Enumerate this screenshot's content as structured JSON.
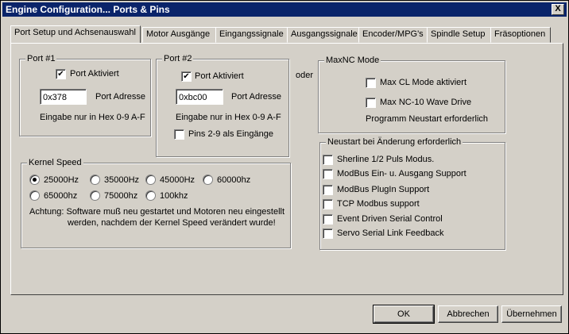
{
  "window": {
    "title": "Engine Configuration... Ports & Pins",
    "close_glyph": "X"
  },
  "tabs": [
    {
      "label": "Port Setup und Achsenauswahl",
      "active": true
    },
    {
      "label": "Motor Ausgänge"
    },
    {
      "label": "Eingangssignale"
    },
    {
      "label": "Ausgangssignale"
    },
    {
      "label": "Encoder/MPG's"
    },
    {
      "label": "Spindle Setup"
    },
    {
      "label": "Fräsoptionen"
    }
  ],
  "port1": {
    "title": "Port #1",
    "enabled_label": "Port Aktiviert",
    "enabled": true,
    "address_value": "0x378",
    "address_label": "Port Adresse",
    "hint": "Eingabe nur in Hex 0-9 A-F"
  },
  "port2": {
    "title": "Port #2",
    "enabled_label": "Port Aktiviert",
    "enabled": true,
    "address_value": "0xbc00",
    "address_label": "Port Adresse",
    "hint": "Eingabe nur in Hex 0-9 A-F",
    "pins_label": "Pins 2-9 als Eingänge",
    "pins_checked": false
  },
  "oder_label": "oder",
  "maxnc": {
    "title": "MaxNC Mode",
    "cl_label": "Max CL Mode aktiviert",
    "wave_label": "Max NC-10 Wave Drive",
    "note": "Programm Neustart erforderlich"
  },
  "kernel": {
    "title": "Kernel Speed",
    "options": [
      "25000Hz",
      "35000Hz",
      "45000Hz",
      "60000hz",
      "65000hz",
      "75000hz",
      "100khz"
    ],
    "selected": "25000Hz",
    "warning_line1": "Achtung: Software muß neu gestartet und Motoren neu eingestellt",
    "warning_line2": "werden, nachdem der Kernel Speed verändert wurde!"
  },
  "restart": {
    "title": "Neustart bei Änderung erforderlich",
    "items": [
      "Sherline 1/2 Puls Modus.",
      "ModBus Ein- u. Ausgang Support",
      "ModBus PlugIn Support",
      "TCP Modbus support",
      "Event Driven Serial Control",
      "Servo Serial Link Feedback"
    ]
  },
  "buttons": {
    "ok": "OK",
    "cancel": "Abbrechen",
    "apply": "Übernehmen"
  }
}
